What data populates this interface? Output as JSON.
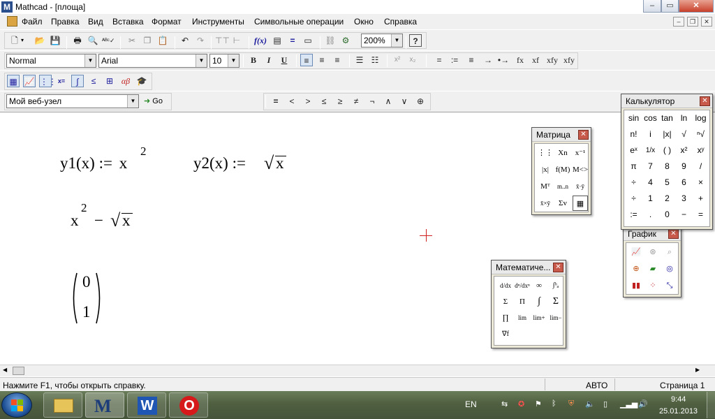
{
  "window": {
    "title": "Mathcad - [площа]",
    "app_icon": "mathcad-app-icon"
  },
  "menubar": {
    "items": [
      "Файл",
      "Правка",
      "Вид",
      "Вставка",
      "Формат",
      "Инструменты",
      "Символьные операции",
      "Окно",
      "Справка"
    ]
  },
  "toolbar_standard": {
    "zoom": "200%",
    "icons": [
      "new-icon",
      "open-icon",
      "save-icon",
      "print-icon",
      "print-preview-icon",
      "spell-check-icon",
      "cut-icon",
      "copy-icon",
      "paste-icon",
      "undo-icon",
      "redo-icon",
      "align-horizontal-icon",
      "align-vertical-icon",
      "insert-function-icon",
      "insert-unit-icon",
      "calculate-icon",
      "insert-component-icon",
      "resource-center-icon",
      "help-icon"
    ]
  },
  "toolbar_formatting": {
    "style": "Normal",
    "font": "Arial",
    "size": "10",
    "bold": "B",
    "italic": "I",
    "underline": "U",
    "extra": [
      "x²",
      "x₂"
    ],
    "symbols": [
      "=",
      ":=",
      "≡",
      "→",
      "•→",
      "fx",
      "xf",
      "xfy",
      "xfy"
    ]
  },
  "toolbar_math": {
    "icons": [
      "calculator-toolbar-icon",
      "graph-toolbar-icon",
      "matrix-toolbar-icon",
      "evaluation-toolbar-icon",
      "calculus-toolbar-icon",
      "boolean-toolbar-icon",
      "programming-toolbar-icon",
      "greek-toolbar-icon",
      "symbolic-toolbar-icon"
    ]
  },
  "toolbar_web": {
    "address": "Мой веб-узел",
    "go": "Go"
  },
  "toolbar_boolean": {
    "symbols": [
      "=",
      "<",
      ">",
      "≤",
      "≥",
      "≠",
      "¬",
      "∧",
      "∨",
      "⊕"
    ]
  },
  "worksheet": {
    "def1_lhs": "y1(x) :=",
    "def1_base": "x",
    "def1_exp": "2",
    "def2_lhs": "y2(x) :=",
    "def2_arg": "x",
    "expr_base": "x",
    "expr_exp": "2",
    "expr_minus": "−",
    "expr_arg": "x",
    "matrix_top": "0",
    "matrix_bottom": "1"
  },
  "palettes": {
    "matrix": {
      "title": "Матрица",
      "items": [
        "⋮⋮",
        "Xn",
        "x⁻¹",
        "|x|",
        "f(M)",
        "M<>",
        "Mᵀ",
        "m..n",
        "x̄·ȳ",
        "x̄×ȳ",
        "Σv",
        "▦"
      ]
    },
    "calculator": {
      "title": "Калькулятор",
      "rows": [
        [
          "sin",
          "cos",
          "tan",
          "ln",
          "log"
        ],
        [
          "n!",
          "i",
          "|x|",
          "√",
          "ⁿ√"
        ],
        [
          "eˣ",
          "1/x",
          "( )",
          "x²",
          "xʸ"
        ],
        [
          "π",
          "7",
          "8",
          "9",
          "/"
        ],
        [
          "÷",
          "4",
          "5",
          "6",
          "×"
        ],
        [
          "÷",
          "1",
          "2",
          "3",
          "+"
        ],
        [
          ":=",
          ".",
          "0",
          "−",
          "="
        ]
      ]
    },
    "graph": {
      "title": "График",
      "items": [
        "xy-plot-icon",
        "polar-plot-icon",
        "zoom-icon",
        "polar-grid-icon",
        "surface-plot-icon",
        "contour-plot-icon",
        "bar-3d-icon",
        "scatter-3d-icon",
        "vector-field-icon"
      ]
    },
    "calculus": {
      "title": "Математиче...",
      "items": [
        "d/dx",
        "dⁿ/dxⁿ",
        "∞",
        "∫ᵇₐ",
        "Σ",
        "Π",
        "∫",
        "Σ",
        "∏",
        "lim",
        "lim+",
        "lim−",
        "∇f"
      ]
    }
  },
  "statusbar": {
    "help": "Нажмите F1, чтобы открыть справку.",
    "mode": "АВТО",
    "page": "Страница 1"
  },
  "taskbar": {
    "lang": "EN",
    "time": "9:44",
    "date": "25.01.2013"
  }
}
